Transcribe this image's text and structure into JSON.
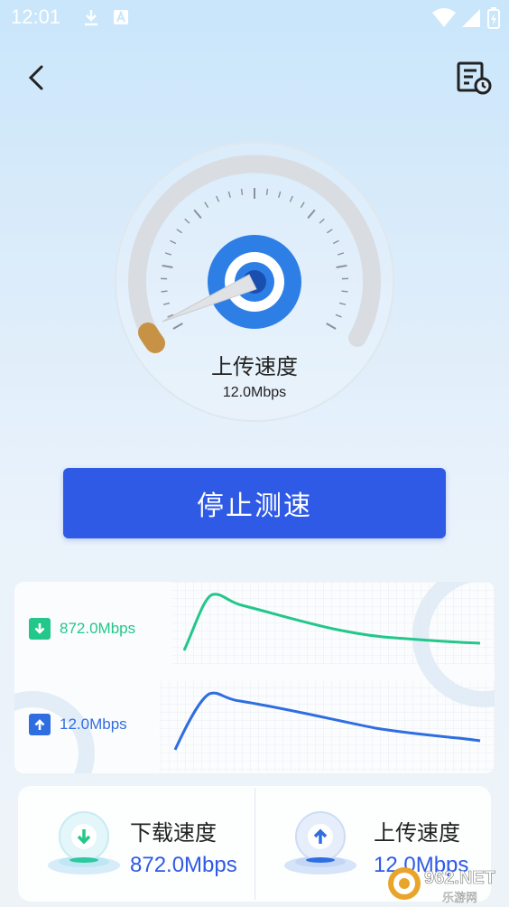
{
  "status": {
    "time": "12:01"
  },
  "appbar": {
    "back_icon": "chevron-left-icon",
    "history_icon": "report-clock-icon"
  },
  "gauge": {
    "title": "上传速度",
    "value": "12.0Mbps",
    "needle_level": 0.05
  },
  "action": {
    "stop_label": "停止测速"
  },
  "graphs": {
    "download": {
      "rate": "872.0Mbps",
      "color": "#23c78a"
    },
    "upload": {
      "rate": "12.0Mbps",
      "color": "#2f6ee0"
    }
  },
  "summary": {
    "download_label": "下载速度",
    "download_value": "872.0Mbps",
    "upload_label": "上传速度",
    "upload_value": "12.0Mbps"
  },
  "watermark": {
    "brand": "962.NET",
    "sub": "乐游网"
  },
  "colors": {
    "accent": "#2f5ae6",
    "download": "#23c78a",
    "upload": "#2f6ee0"
  }
}
